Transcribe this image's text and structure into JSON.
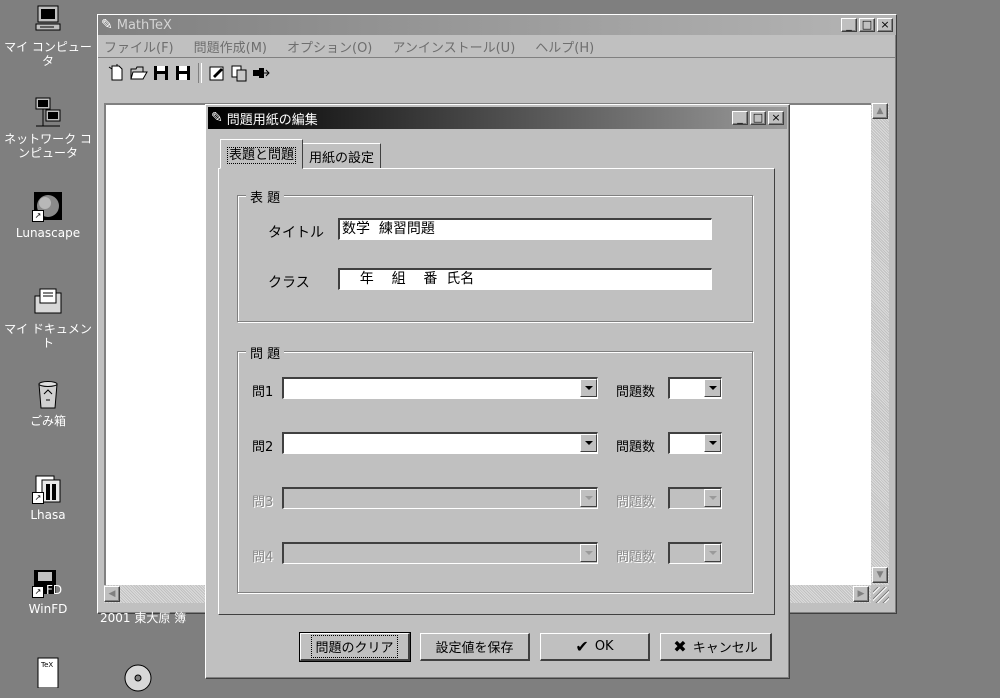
{
  "desktop": {
    "icons": [
      {
        "label": "マイ コンピュータ",
        "icon": "my-computer-icon"
      },
      {
        "label": "ネットワーク コンピュータ",
        "icon": "network-icon"
      },
      {
        "label": "Lunascape",
        "icon": "lunascape-icon"
      },
      {
        "label": "マイ ドキュメント",
        "icon": "my-documents-icon"
      },
      {
        "label": "ごみ箱",
        "icon": "recycle-bin-icon"
      },
      {
        "label": "Lhasa",
        "icon": "lhasa-icon"
      },
      {
        "label": "WinFD",
        "icon": "winfd-icon"
      }
    ],
    "bottom_label": "2001 東大原 簿"
  },
  "main_window": {
    "title": "MathTeX",
    "menu": [
      "ファイル(F)",
      "問題作成(M)",
      "オプション(O)",
      "アンインストール(U)",
      "ヘルプ(H)"
    ],
    "caption_buttons": [
      "_",
      "□",
      "×"
    ]
  },
  "dialog": {
    "title": "問題用紙の編集",
    "tabs": [
      "表題と問題",
      "用紙の設定"
    ],
    "header_group": {
      "legend": "表 題",
      "title_label": "タイトル",
      "title_value": "数学  練習問題",
      "class_label": "クラス",
      "class_value": "    年    組    番  氏名"
    },
    "problems_group": {
      "legend": "問 題",
      "count_label": "問題数",
      "rows": [
        {
          "label": "問1",
          "enabled": true
        },
        {
          "label": "問2",
          "enabled": true
        },
        {
          "label": "問3",
          "enabled": false
        },
        {
          "label": "問4",
          "enabled": false
        }
      ]
    },
    "buttons": {
      "clear": "問題のクリア",
      "save": "設定値を保存",
      "ok": "OK",
      "cancel": "キャンセル"
    }
  }
}
